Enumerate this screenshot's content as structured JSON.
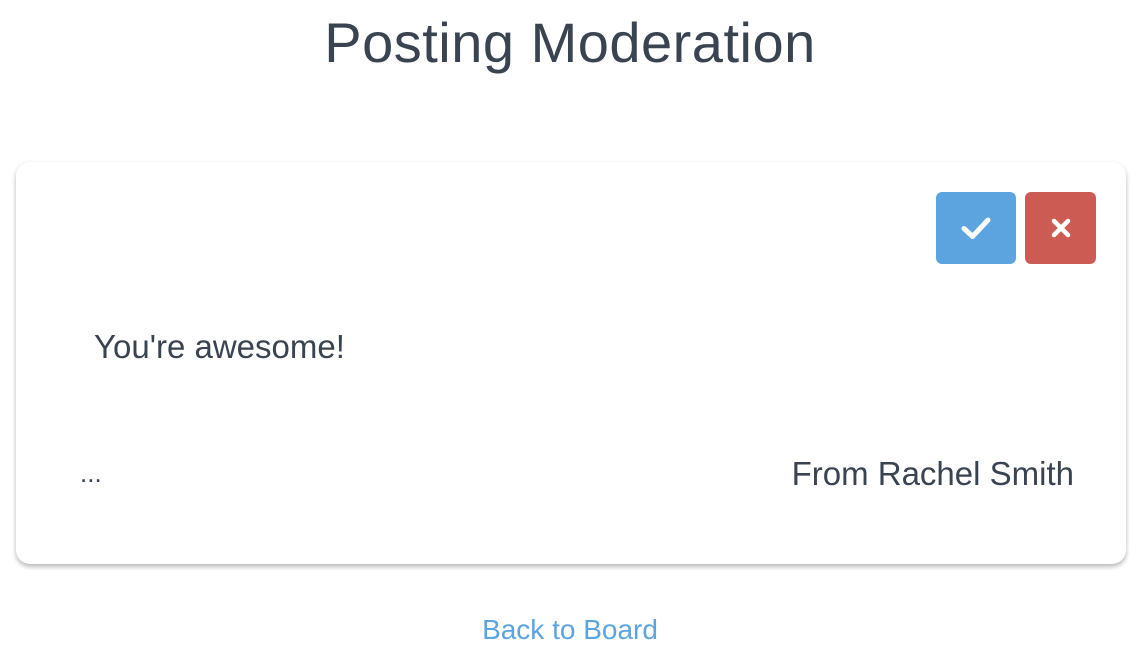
{
  "page": {
    "title": "Posting Moderation"
  },
  "post": {
    "message": "You're awesome!",
    "more_label": "...",
    "author": "From Rachel Smith",
    "approve_icon": "check-icon",
    "reject_icon": "close-icon"
  },
  "footer": {
    "back_link": "Back to Board"
  },
  "colors": {
    "approve": "#5ba4e0",
    "reject": "#cc5b53",
    "link": "#5ba4e0",
    "text": "#3a4350"
  }
}
